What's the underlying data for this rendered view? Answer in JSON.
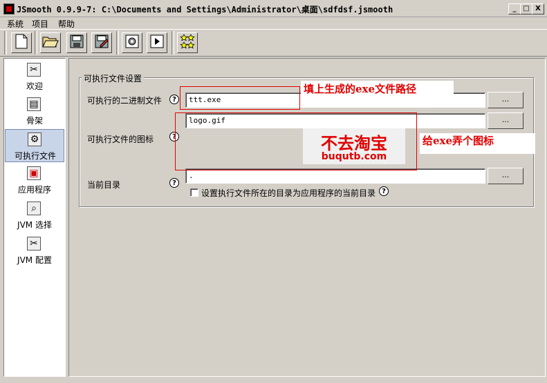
{
  "window": {
    "title": "JSmooth 0.9.9-7: C:\\Documents and Settings\\Administrator\\桌面\\sdfdsf.jsmooth",
    "controls": [
      "_",
      "□",
      "X"
    ]
  },
  "menu": [
    "系统",
    "项目",
    "帮助"
  ],
  "toolbar": {
    "icons": [
      "new-file-icon",
      "open-folder-icon",
      "save-icon",
      "save-as-icon",
      "compile-gear-icon",
      "run-icon",
      "stars-icon"
    ]
  },
  "sidebar": {
    "items": [
      {
        "label": "欢迎",
        "icon": "tools-icon"
      },
      {
        "label": "骨架",
        "icon": "page-icon"
      },
      {
        "label": "可执行文件",
        "icon": "gear-icon",
        "selected": true
      },
      {
        "label": "应用程序",
        "icon": "app-icon"
      },
      {
        "label": "JVM 选择",
        "icon": "magnifier-icon"
      },
      {
        "label": "JVM 配置",
        "icon": "tools-icon"
      }
    ]
  },
  "settings": {
    "group_title": "可执行文件设置",
    "binary_label": "可执行的二进制文件",
    "binary_value": "ttt.exe",
    "icon_label": "可执行文件的图标",
    "icon_value": "logo.gif",
    "curdir_label": "当前目录",
    "curdir_value": ".",
    "checkbox_label": "设置执行文件所在的目录为应用程序的当前目录",
    "checkbox_checked": false,
    "browse_label": "...",
    "help_glyph": "?"
  },
  "annotations": {
    "binary_note": "填上生成的exe文件路径",
    "icon_note": "给exe弄个图标",
    "logo_big": "不去淘宝",
    "logo_small": "buqutb.com"
  }
}
